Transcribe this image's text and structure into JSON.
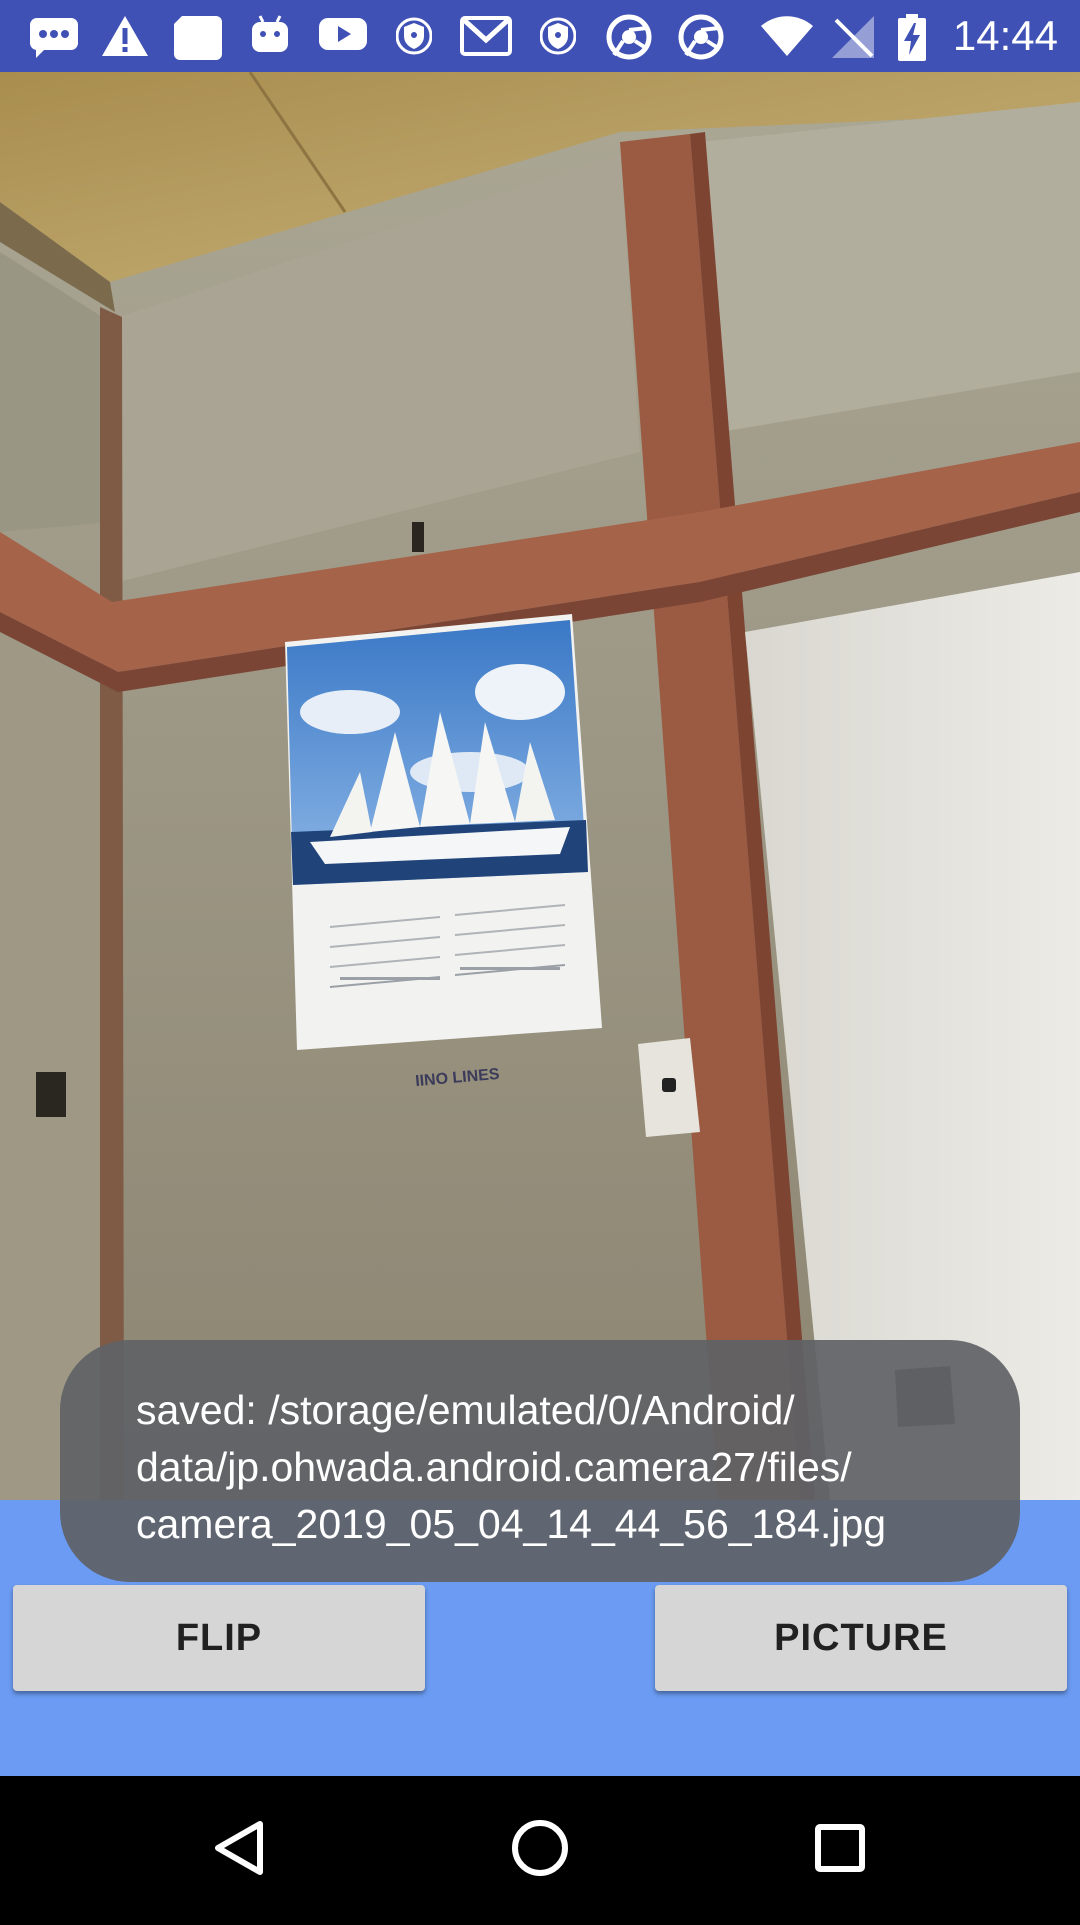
{
  "status_bar": {
    "time": "14:44",
    "icons": [
      "chat-notification-icon",
      "warning-icon",
      "sd-card-icon",
      "android-icon",
      "youtube-icon",
      "vpn-shield-icon",
      "gmail-icon",
      "vpn-shield-icon",
      "chrome-icon",
      "chrome-icon",
      "wifi-icon",
      "no-signal-icon",
      "battery-charging-icon"
    ],
    "background_color": "#3f51b5"
  },
  "camera_preview": {
    "calendar_caption": "IINO LINES"
  },
  "toast": {
    "lines": [
      "saved: /storage/emulated/0/Android/",
      "data/jp.ohwada.android.camera27/files/",
      "camera_2019_05_04_14_44_56_184.jpg"
    ]
  },
  "controls": {
    "flip_label": "FLIP",
    "picture_label": "PICTURE",
    "background_color": "#6b9bf2"
  },
  "nav_bar": {
    "buttons": [
      "back-icon",
      "home-icon",
      "recents-icon"
    ]
  }
}
